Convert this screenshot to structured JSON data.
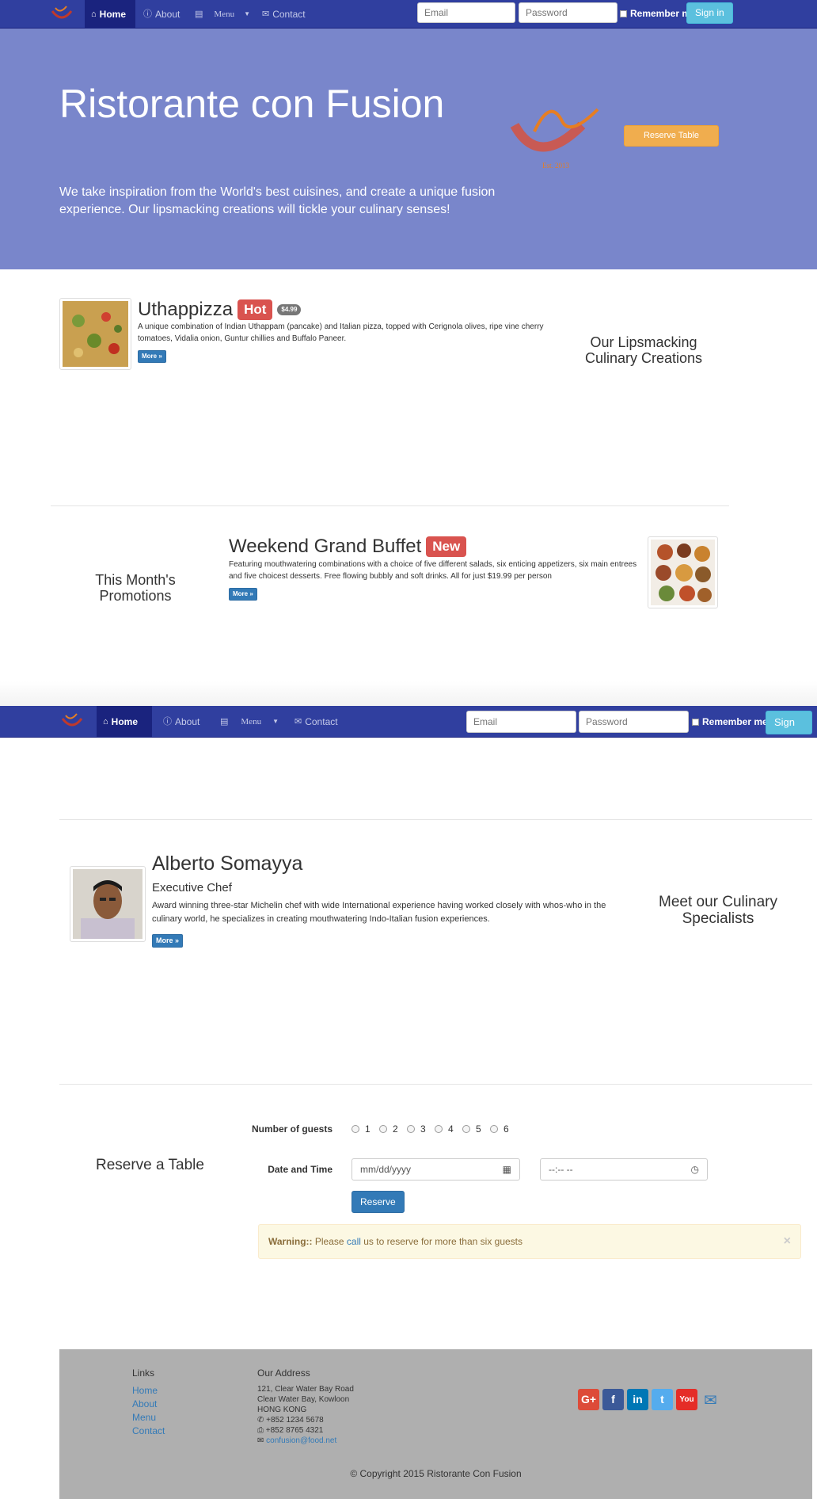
{
  "navbar": {
    "home": "Home",
    "about": "About",
    "menu": "Menu",
    "contact": "Contact",
    "email_placeholder": "Email",
    "password_placeholder": "Password",
    "remember": "Remember me",
    "signin": "Sign in"
  },
  "jumbotron": {
    "title": "Ristorante con Fusion",
    "description": "We take inspiration from the World's best cuisines, and create a unique fusion experience. Our lipsmacking creations will tickle your culinary senses!",
    "logo_text": "Ristorante con Fusion",
    "logo_est": "Est. 2013",
    "reserve_button": "Reserve Table"
  },
  "dish": {
    "name": "Uthappizza",
    "label": "Hot",
    "price": "$4.99",
    "description": "A unique combination of Indian Uthappam (pancake) and Italian pizza, topped with Cerignola olives, ripe vine cherry tomatoes, Vidalia onion, Guntur chillies and Buffalo Paneer.",
    "more": "More »",
    "section_title": "Our Lipsmacking Culinary Creations"
  },
  "promotion": {
    "section_title": "This Month's Promotions",
    "name": "Weekend Grand Buffet",
    "label": "New",
    "description": "Featuring mouthwatering combinations with a choice of five different salads, six enticing appetizers, six main entrees and five choicest desserts. Free flowing bubbly and soft drinks. All for just $19.99 per person",
    "more": "More »"
  },
  "leader": {
    "name": "Alberto Somayya",
    "role": "Executive Chef",
    "description": "Award winning three-star Michelin chef with wide International experience having worked closely with whos-who in the culinary world, he specializes in creating mouthwatering Indo-Italian fusion experiences.",
    "more": "More »",
    "section_title": "Meet our Culinary Specialists"
  },
  "reservation": {
    "section_title": "Reserve a Table",
    "guests_label": "Number of guests",
    "guest_options": [
      "1",
      "2",
      "3",
      "4",
      "5",
      "6"
    ],
    "datetime_label": "Date and Time",
    "date_placeholder": "mm/dd/yyyy",
    "time_placeholder": "--:-- --",
    "reserve_button": "Reserve",
    "warning_strong": "Warning::",
    "warning_pre": " Please ",
    "warning_link": "call",
    "warning_post": " us to reserve for more than six guests",
    "close": "×"
  },
  "footer": {
    "links_title": "Links",
    "links": [
      "Home",
      "About",
      "Menu",
      "Contact"
    ],
    "address_title": "Our Address",
    "address_lines": [
      "121, Clear Water Bay Road",
      "Clear Water Bay, Kowloon",
      "HONG KONG"
    ],
    "phone": "+852 1234 5678",
    "fax": "+852 8765 4321",
    "email": "confusion@food.net",
    "social": [
      {
        "name": "google-plus",
        "glyph": "G+",
        "color": "#dd4b39"
      },
      {
        "name": "facebook",
        "glyph": "f",
        "color": "#3b5998"
      },
      {
        "name": "linkedin",
        "glyph": "in",
        "color": "#0077b5"
      },
      {
        "name": "twitter",
        "glyph": "t",
        "color": "#55acee"
      },
      {
        "name": "youtube",
        "glyph": "You",
        "color": "#e52d27"
      }
    ],
    "copyright": "© Copyright 2015 Ristorante Con Fusion"
  },
  "colors": {
    "navbar": "#303f9f",
    "navbar_active": "#1a237e",
    "jumbotron": "#7986cb",
    "accent_orange": "#f0ad4e",
    "primary": "#337ab7",
    "danger": "#d9534f"
  }
}
